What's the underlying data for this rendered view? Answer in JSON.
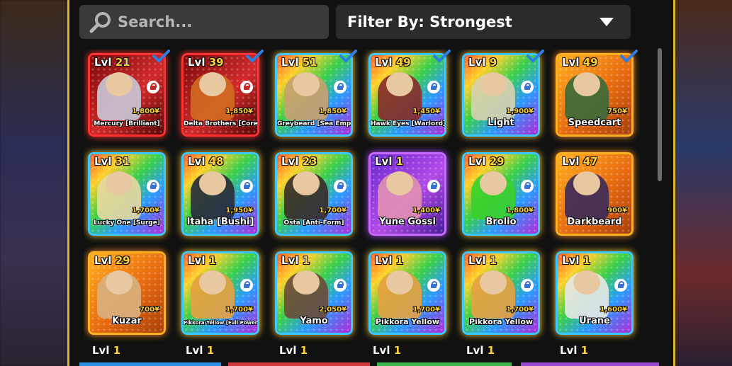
{
  "search": {
    "placeholder": "Search..."
  },
  "filter": {
    "label": "Filter By: Strongest"
  },
  "lvl_prefix": "Lvl",
  "cards": [
    {
      "lvl": "21",
      "price": "1,800¥",
      "name": "Mercury [Brilliant]",
      "size": "small",
      "checked": true,
      "lock": "red",
      "rarity": "red"
    },
    {
      "lvl": "39",
      "price": "1,850¥",
      "name": "Delta Brothers [Core]",
      "size": "small",
      "checked": true,
      "lock": "red",
      "rarity": "red"
    },
    {
      "lvl": "51",
      "price": "1,850¥",
      "name": "Greybeard [Sea Emperor]",
      "size": "small",
      "checked": true,
      "lock": "blue",
      "rarity": "rainbow"
    },
    {
      "lvl": "49",
      "price": "1,450¥",
      "name": "Hawk Eyes [Warlord]",
      "size": "small",
      "checked": true,
      "lock": "blue",
      "rarity": "rainbow"
    },
    {
      "lvl": "9",
      "price": "1,900¥",
      "name": "Light",
      "size": "big",
      "checked": true,
      "lock": "blue",
      "rarity": "rainbow"
    },
    {
      "lvl": "49",
      "price": "750¥",
      "name": "Speedcart",
      "size": "big",
      "checked": true,
      "lock": "none",
      "rarity": "gold"
    },
    {
      "lvl": "31",
      "price": "1,700¥",
      "name": "Lucky One [Surge]",
      "size": "small",
      "checked": false,
      "lock": "blue",
      "rarity": "rainbow"
    },
    {
      "lvl": "48",
      "price": "1,950¥",
      "name": "Itaha [Bushi]",
      "size": "big",
      "checked": false,
      "lock": "blue",
      "rarity": "rainbow"
    },
    {
      "lvl": "23",
      "price": "1,700¥",
      "name": "Osta [Anti-Form]",
      "size": "small",
      "checked": false,
      "lock": "blue",
      "rarity": "rainbow"
    },
    {
      "lvl": "1",
      "price": "1,400¥",
      "name": "Yune Gossi",
      "size": "big",
      "checked": false,
      "lock": "blue",
      "rarity": "purple"
    },
    {
      "lvl": "29",
      "price": "1,800¥",
      "name": "Brolio",
      "size": "big",
      "checked": false,
      "lock": "blue",
      "rarity": "rainbow"
    },
    {
      "lvl": "47",
      "price": "900¥",
      "name": "Darkbeard",
      "size": "big",
      "checked": false,
      "lock": "none",
      "rarity": "gold"
    },
    {
      "lvl": "29",
      "price": "700¥",
      "name": "Kuzar",
      "size": "big",
      "checked": false,
      "lock": "none",
      "rarity": "gold"
    },
    {
      "lvl": "1",
      "price": "1,700¥",
      "name": "Pikkora Yellow [Full Power]",
      "size": "tiny",
      "checked": false,
      "lock": "blue",
      "rarity": "rainbow"
    },
    {
      "lvl": "1",
      "price": "2,050¥",
      "name": "Yamo",
      "size": "big",
      "checked": false,
      "lock": "blue",
      "rarity": "rainbow"
    },
    {
      "lvl": "1",
      "price": "1,700¥",
      "name": "Pikkora Yellow",
      "size": "med",
      "checked": false,
      "lock": "blue",
      "rarity": "rainbow"
    },
    {
      "lvl": "1",
      "price": "1,700¥",
      "name": "Pikkora Yellow",
      "size": "med",
      "checked": false,
      "lock": "blue",
      "rarity": "rainbow"
    },
    {
      "lvl": "1",
      "price": "1,600¥",
      "name": "Urane",
      "size": "big",
      "checked": false,
      "lock": "blue",
      "rarity": "rainbow"
    }
  ],
  "partial_row_levels": [
    "1",
    "1",
    "1",
    "1",
    "1",
    "1"
  ],
  "colors": {
    "frame_border": "#d9b52a",
    "level_number": "#ffd23a",
    "price": "#ffd23a",
    "check": "#2d7fe6"
  }
}
